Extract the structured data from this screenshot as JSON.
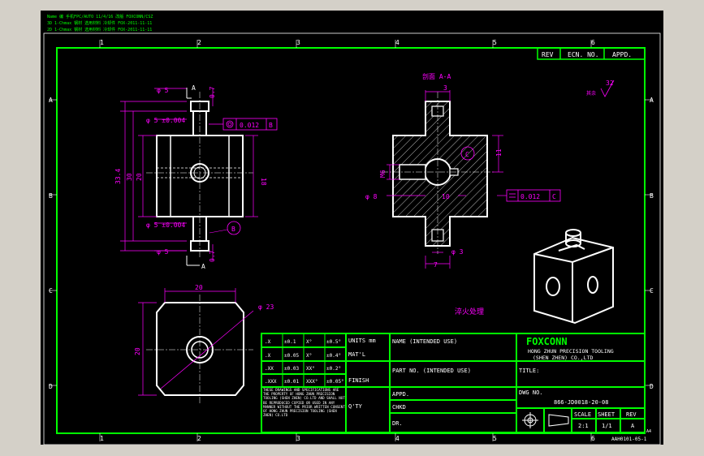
{
  "colors": {
    "background": "#d4d0c8",
    "drawing_bg": "#000000",
    "frame": "#00ff00",
    "geometry": "#ffffff",
    "dimension": "#ff00ff",
    "text": "#ffffff"
  },
  "notes": {
    "line1": "Name 编 手机FPC/AUTO 11/4/16 改版 FOXCONN/CSZ",
    "line2": "3D 1-Chmax 钢材 选用材料 冷却件 FOX-2011-11-11",
    "line3": "2D 1-Chmax 钢材 选用材料 冷却件 FOX-2011-11-11"
  },
  "zone_cols": [
    "1",
    "2",
    "3",
    "4",
    "5",
    "6"
  ],
  "zone_rows": [
    "A",
    "B",
    "C",
    "D"
  ],
  "revision_header": {
    "rev": "REV",
    "ecn": "ECN. NO.",
    "appd": "APPD."
  },
  "front_view": {
    "d_top": "φ 5 ±0.004",
    "d_top2": "φ 5",
    "d_bot": "φ 5 ±0.004",
    "d_bot2": "φ 5",
    "h_overall": "33.4",
    "h_30": "30",
    "h_20": "20",
    "w_18": "18",
    "t_top": "0.7",
    "t_bot": "0.7",
    "flatness": "0.012",
    "datum_b": "B",
    "section": "A",
    "balloon": "B"
  },
  "section_view": {
    "title": "剖面 A-A",
    "dim_3": "3",
    "dim_m6": "M6",
    "dim_d8": "φ 8",
    "dim_7": "7",
    "dim_d3": "φ 3",
    "dim_10": "10",
    "dim_11": "11",
    "tol": "0.012",
    "datum_c": "C",
    "balloon": "C"
  },
  "bottom_view": {
    "dim_20w": "20",
    "dim_20h": "20",
    "dim_d23": "φ 23"
  },
  "surface_finish": {
    "value": "32",
    "label": "其余"
  },
  "note_heat": "淬火处理",
  "title_block": {
    "tol_rows": [
      [
        ".X",
        "±0.1",
        "X°",
        "±0.5°"
      ],
      [
        ".X",
        "±0.05",
        "X°",
        "±0.4°"
      ],
      [
        ".XX",
        "±0.03",
        "XX°",
        "±0.2°"
      ],
      [
        ".XXX",
        "±0.01",
        "XXX°",
        "±0.05°"
      ]
    ],
    "units": "UNITS mm",
    "matl": "MAT'L",
    "finish": "FINISH",
    "qty": "Q'TY",
    "note": "THESE DRAWINGS AND SPECIFICATIONS ARE THE PROPERTY OF HONG ZHUN PRECISION TOOLING (SHEN ZHEN) CO.LTD AND SHALL NOT BE REPRODUCED COPIED OR USED IN ANY MANNER WITHOUT THE PRIOR WRITTEN CONSENT OF HONG ZHUN PRECISION TOOLING (SHEN ZHEN) CO.LTD",
    "name": "NAME (INTENDED USE)",
    "part_no": "PART NO. (INTENDED USE)",
    "appd": "APPD.",
    "chkd": "CHKD",
    "dr": "DR.",
    "company": "FOXCONN",
    "company_line1": "HONG ZHUN PRECISION TOOLING",
    "company_line2": "(SHEN ZHEN) CO.,LTD",
    "title_lbl": "TITLE:",
    "dwg_lbl": "DWG NO.",
    "dwg_no": "866-JD0018-20-08",
    "scale_lbl": "SCALE",
    "scale": "2:1",
    "sheet_lbl": "SHEET",
    "sheet": "1/1",
    "rev_lbl": "REV",
    "rev": "A"
  },
  "form_no": "AAH0101-05-1",
  "sheet_size": "A4"
}
